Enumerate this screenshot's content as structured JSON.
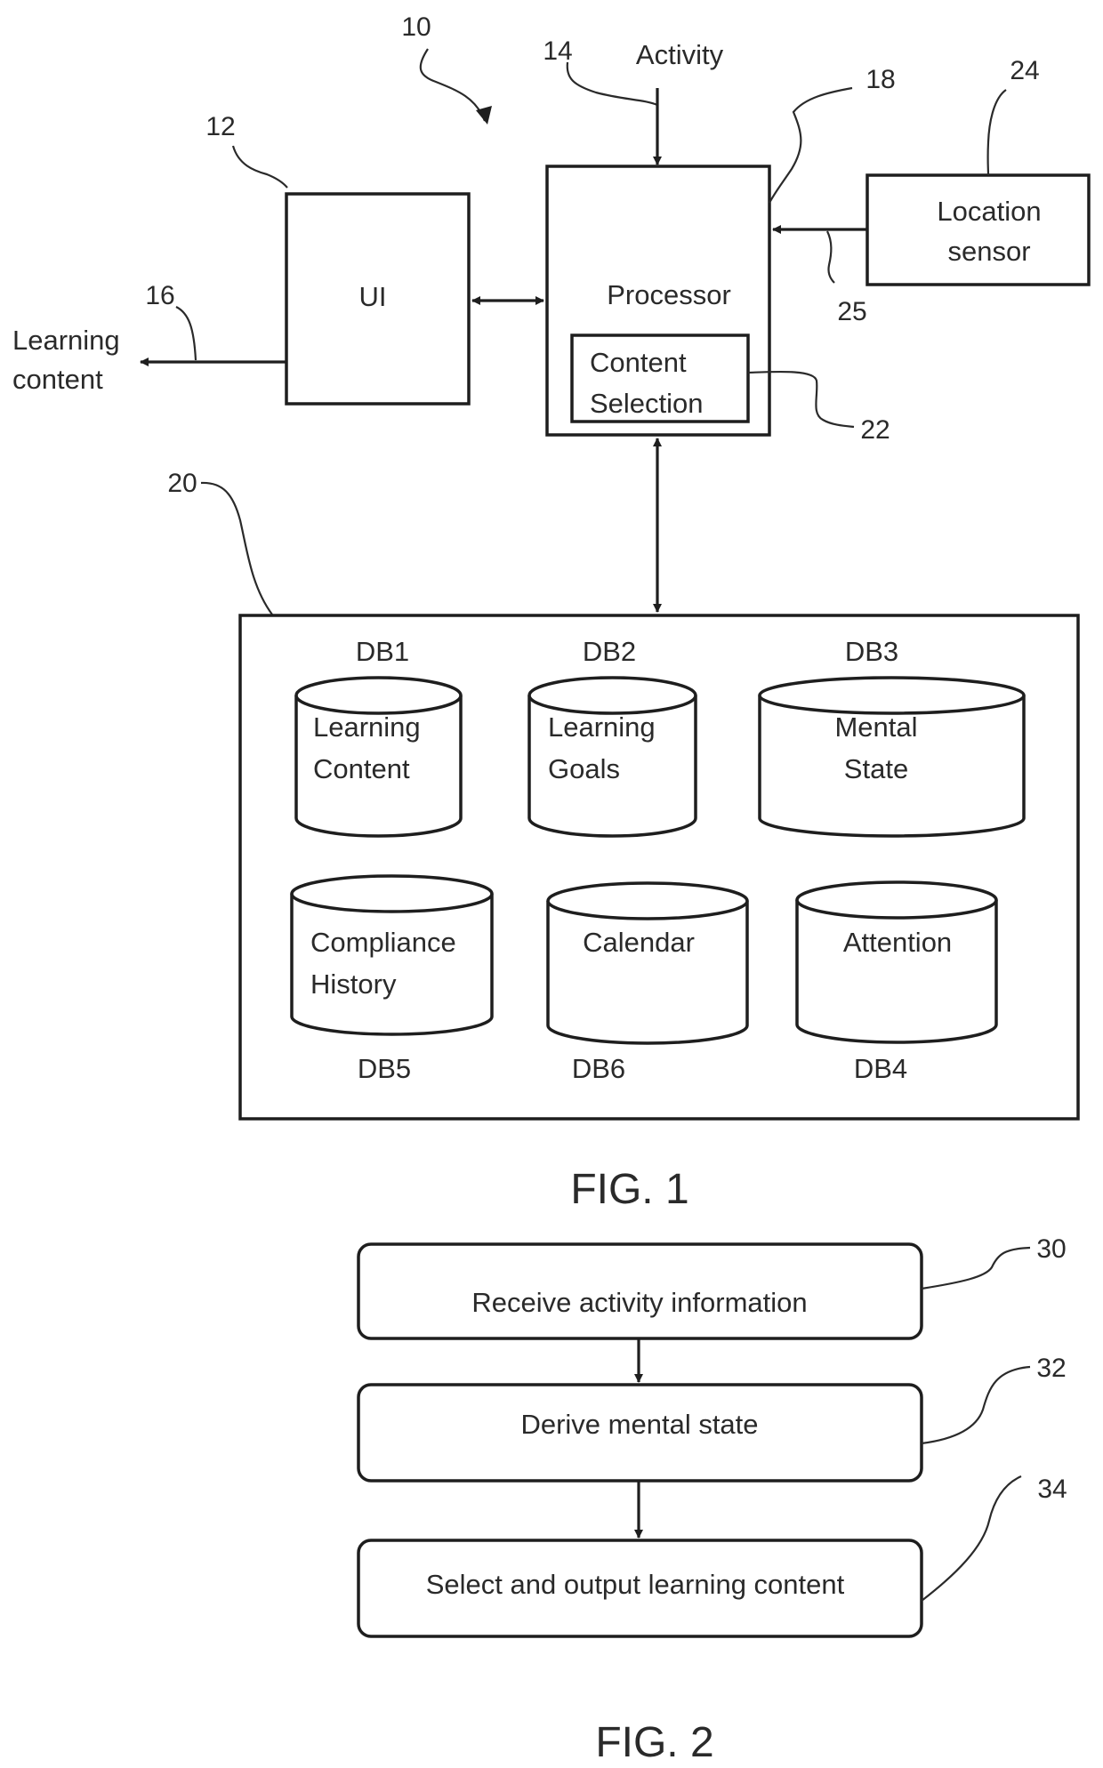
{
  "figure1": {
    "caption": "FIG. 1",
    "system_ref": "10",
    "ui": {
      "label": "UI",
      "ref": "12"
    },
    "activity": {
      "label": "Activity",
      "ref": "14"
    },
    "output": {
      "label_line1": "Learning",
      "label_line2": "content",
      "ref": "16"
    },
    "processor": {
      "label": "Processor",
      "ref": "18"
    },
    "content_selection": {
      "label_line1": "Content",
      "label_line2": "Selection",
      "ref": "22"
    },
    "location_sensor": {
      "label_line1": "Location",
      "label_line2": "sensor",
      "ref": "24",
      "link_ref": "25"
    },
    "database_group": {
      "ref": "20",
      "databases": [
        {
          "id": "DB1",
          "line1": "Learning",
          "line2": "Content"
        },
        {
          "id": "DB2",
          "line1": "Learning",
          "line2": "Goals"
        },
        {
          "id": "DB3",
          "line1": "Mental",
          "line2": "State"
        },
        {
          "id": "DB5",
          "line1": "Compliance",
          "line2": "History"
        },
        {
          "id": "DB6",
          "line1": "Calendar",
          "line2": ""
        },
        {
          "id": "DB4",
          "line1": "Attention",
          "line2": ""
        }
      ]
    }
  },
  "figure2": {
    "caption": "FIG. 2",
    "steps": [
      {
        "ref": "30",
        "label": "Receive activity information"
      },
      {
        "ref": "32",
        "label": "Derive mental state"
      },
      {
        "ref": "34",
        "label": "Select and output learning content"
      }
    ]
  }
}
